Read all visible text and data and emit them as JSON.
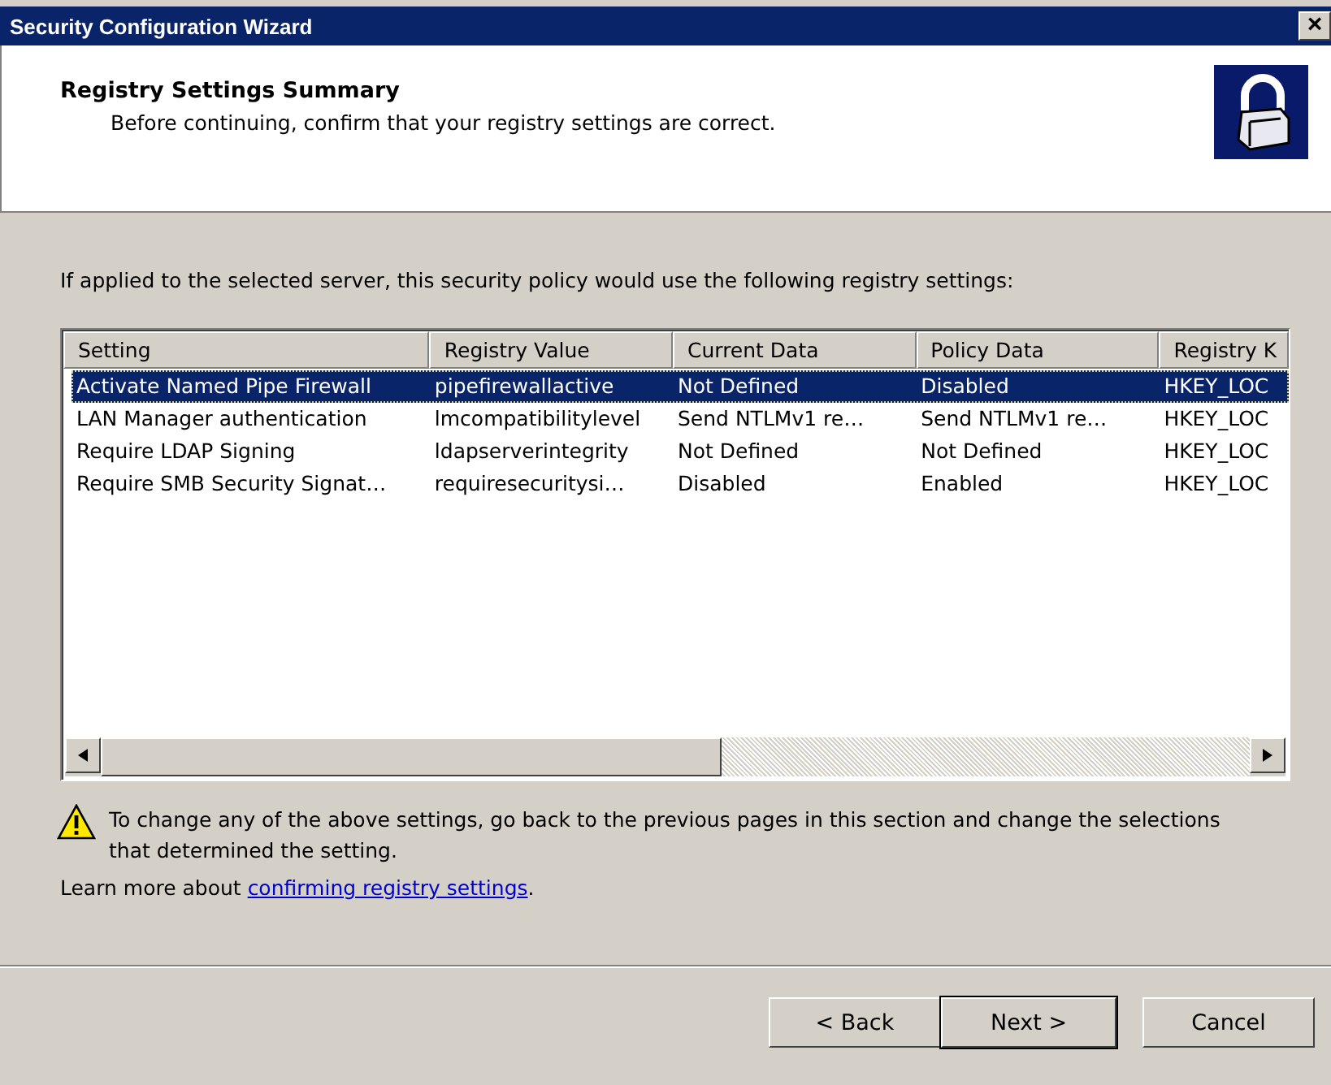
{
  "window": {
    "title": "Security Configuration Wizard",
    "close": "×"
  },
  "header": {
    "title": "Registry Settings Summary",
    "subtitle": "Before continuing, confirm that your registry settings are correct."
  },
  "intro": "If applied to the selected server, this security policy would use the following registry settings:",
  "table": {
    "columns": [
      "Setting",
      "Registry Value",
      "Current Data",
      "Policy Data",
      "Registry K"
    ],
    "rows": [
      {
        "cells": [
          "Activate Named Pipe Firewall",
          "pipefirewallactive",
          "Not Defined",
          "Disabled",
          "HKEY_LOC"
        ],
        "selected": true
      },
      {
        "cells": [
          "LAN Manager authentication",
          "lmcompatibilitylevel",
          "Send NTLMv1 re…",
          "Send NTLMv1 re…",
          "HKEY_LOC"
        ],
        "selected": false
      },
      {
        "cells": [
          "Require LDAP Signing",
          "ldapserverintegrity",
          "Not Defined",
          "Not Defined",
          "HKEY_LOC"
        ],
        "selected": false
      },
      {
        "cells": [
          "Require SMB Security Signat…",
          "requiresecuritysi…",
          "Disabled",
          "Enabled",
          "HKEY_LOC"
        ],
        "selected": false
      }
    ]
  },
  "warning": "To change any of the above settings, go back to the previous pages in this section and change the selections that determined the setting.",
  "learn_more": {
    "prefix": "Learn more about ",
    "link": "confirming registry settings",
    "suffix": "."
  },
  "buttons": [
    {
      "label": "< Back",
      "default": false
    },
    {
      "label": "Next >",
      "default": true
    },
    {
      "label": "Cancel",
      "default": false
    }
  ]
}
